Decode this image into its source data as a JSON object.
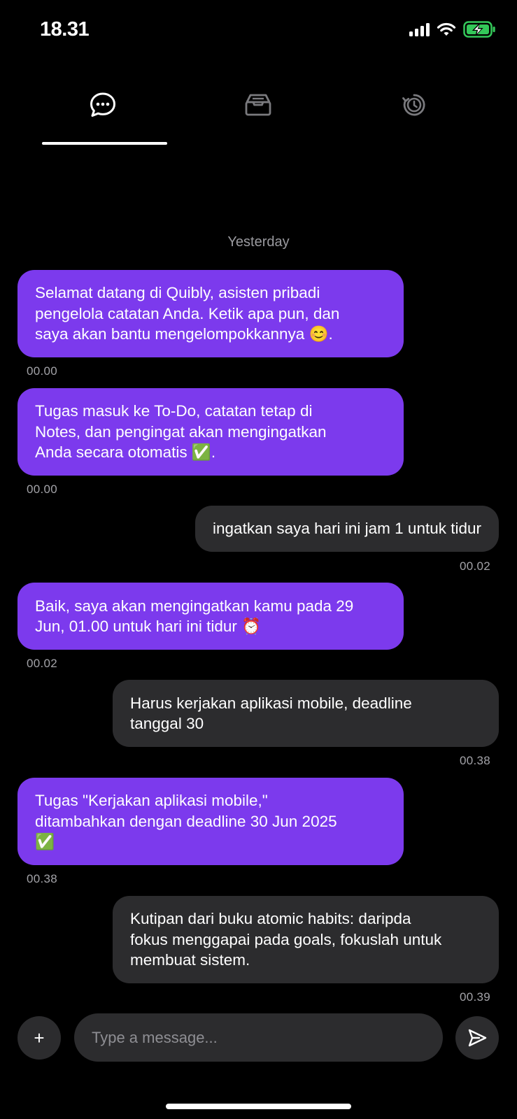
{
  "status": {
    "time": "18.31"
  },
  "tabs": [
    {
      "icon": "chat-bubble-icon",
      "active": true
    },
    {
      "icon": "inbox-tray-icon",
      "active": false
    },
    {
      "icon": "alarm-clock-icon",
      "active": false
    }
  ],
  "chat": {
    "date_separator": "Yesterday",
    "messages": [
      {
        "sender": "bot",
        "text": "Selamat datang di Quibly, asisten pribadi\npengelola catatan Anda. Ketik apa pun, dan\nsaya akan bantu mengelompokkannya 😊.",
        "time": "00.00"
      },
      {
        "sender": "bot",
        "text": "Tugas masuk ke To-Do, catatan tetap di\nNotes, dan pengingat akan mengingatkan\nAnda secara otomatis ✅.",
        "time": "00.00"
      },
      {
        "sender": "user",
        "text": "ingatkan saya hari ini jam 1 untuk tidur",
        "time": "00.02"
      },
      {
        "sender": "bot",
        "text": "Baik, saya akan mengingatkan kamu pada 29\nJun, 01.00 untuk hari ini tidur ⏰",
        "time": "00.02"
      },
      {
        "sender": "user",
        "text": "Harus kerjakan aplikasi mobile, deadline\ntanggal 30",
        "time": "00.38"
      },
      {
        "sender": "bot",
        "text": "Tugas \"Kerjakan aplikasi mobile,\"\nditambahkan dengan deadline 30 Jun 2025\n✅",
        "time": "00.38"
      },
      {
        "sender": "user",
        "text": "Kutipan dari buku atomic habits: daripda\nfokus menggapai pada goals, fokuslah untuk\nmembuat sistem.",
        "time": "00.39"
      }
    ]
  },
  "composer": {
    "plus_label": "+",
    "placeholder": "Type a message..."
  },
  "colors": {
    "background": "#000000",
    "bot_bubble": "#7c3aed",
    "user_bubble": "#2c2c2e",
    "battery": "#34c759"
  }
}
